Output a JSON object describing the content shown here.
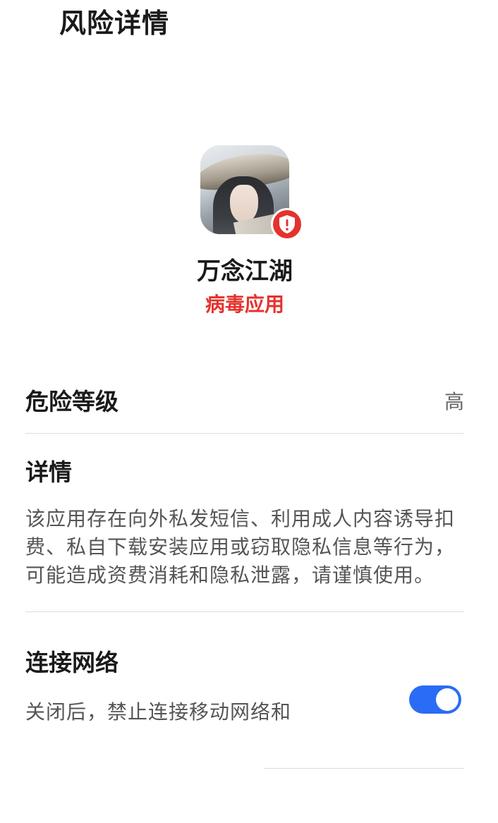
{
  "header": {
    "title": "风险详情"
  },
  "app": {
    "name": "万念江湖",
    "category": "病毒应用",
    "icon": "app-icon-avatar",
    "badge_icon": "shield-alert-icon",
    "category_color": "#e5322d"
  },
  "risk_level": {
    "label": "危险等级",
    "value": "高"
  },
  "details": {
    "label": "详情",
    "text": "该应用存在向外私发短信、利用成人内容诱导扣费、私自下载安装应用或窃取隐私信息等行为，可能造成资费消耗和隐私泄露，请谨慎使用。"
  },
  "network": {
    "label": "连接网络",
    "description": "关闭后，禁止连接移动网络和",
    "toggle_on": true,
    "toggle_color": "#2a6cf5"
  }
}
